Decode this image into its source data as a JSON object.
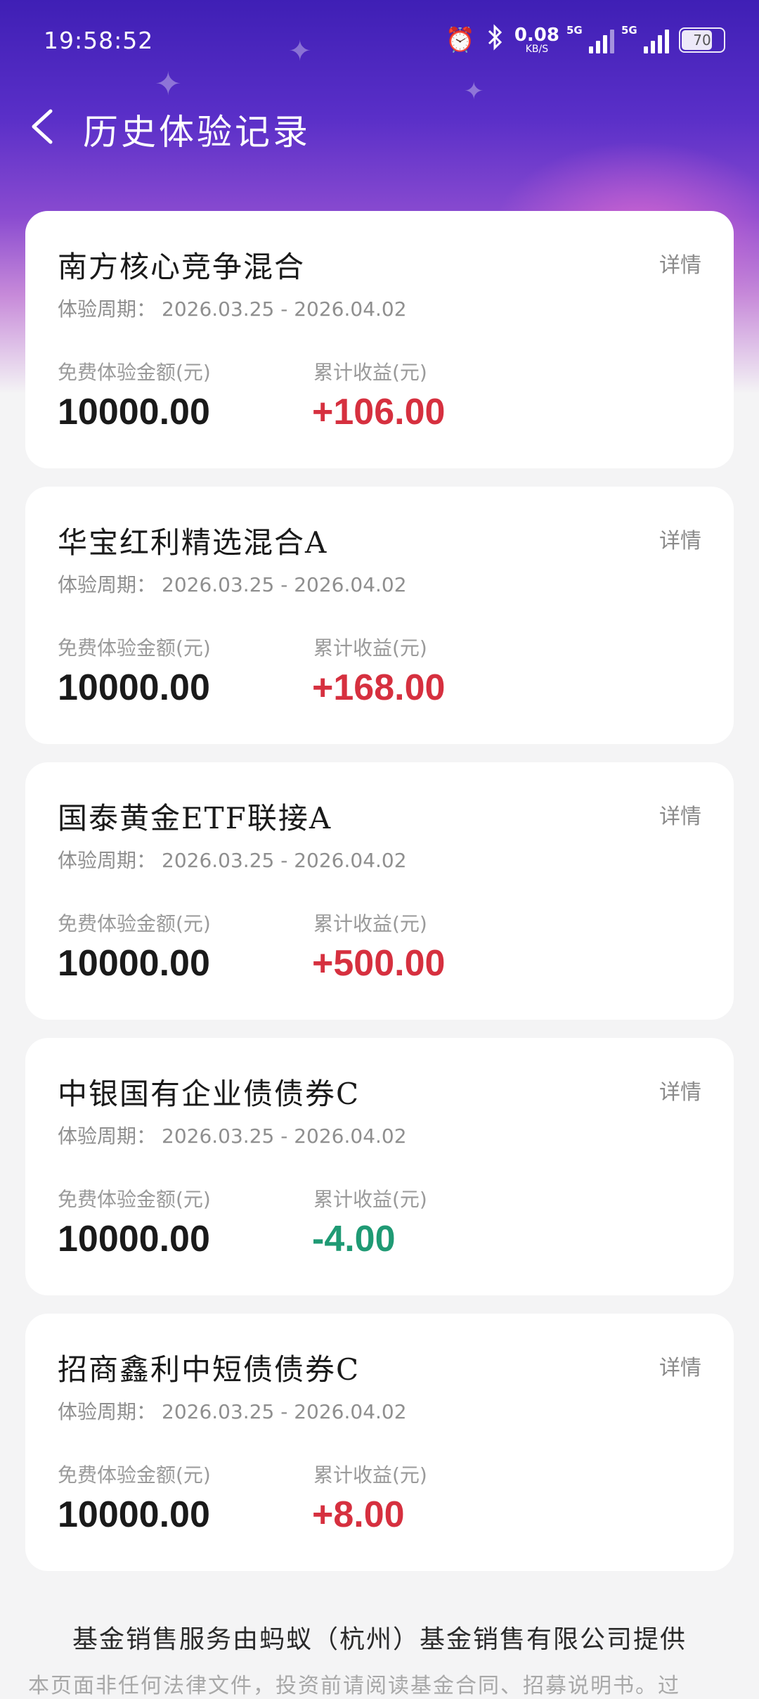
{
  "status_bar": {
    "time": "19:58:52",
    "net_speed_value": "0.08",
    "net_speed_unit": "KB/S",
    "sim1_label": "5G",
    "sim2_label": "5G",
    "battery": "70"
  },
  "header": {
    "title": "历史体验记录"
  },
  "labels": {
    "period_prefix": "体验周期：",
    "amount_label": "免费体验金额(元)",
    "income_label": "累计收益(元)",
    "detail": "详情"
  },
  "records": [
    {
      "name": "南方核心竞争混合",
      "period": "2026.03.25 - 2026.04.02",
      "amount": "10000.00",
      "income": "+106.00",
      "income_color": "#d6303f"
    },
    {
      "name": "华宝红利精选混合A",
      "period": "2026.03.25 - 2026.04.02",
      "amount": "10000.00",
      "income": "+168.00",
      "income_color": "#d6303f"
    },
    {
      "name": "国泰黄金ETF联接A",
      "period": "2026.03.25 - 2026.04.02",
      "amount": "10000.00",
      "income": "+500.00",
      "income_color": "#d6303f"
    },
    {
      "name": "中银国有企业债债券C",
      "period": "2026.03.25 - 2026.04.02",
      "amount": "10000.00",
      "income": "-4.00",
      "income_color": "#1f9a74"
    },
    {
      "name": "招商鑫利中短债债券C",
      "period": "2026.03.25 - 2026.04.02",
      "amount": "10000.00",
      "income": "+8.00",
      "income_color": "#d6303f"
    }
  ],
  "footer": {
    "provider": "基金销售服务由蚂蚁（杭州）基金销售有限公司提供",
    "disclaimer": "本页面非任何法律文件，投资前请阅读基金合同、招募说明书。过"
  }
}
